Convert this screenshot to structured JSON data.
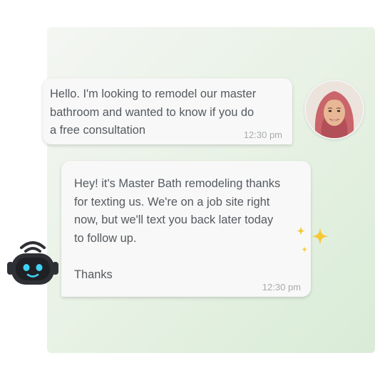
{
  "conversation": {
    "incoming": {
      "text": "Hello. I'm looking to remodel our master\nbathroom and wanted to know if you do\na free consultation",
      "time": "12:30 pm"
    },
    "outgoing": {
      "text": "Hey! it's Master Bath remodeling thanks\nfor texting us. We're on a job site right\nnow, but we'll text you back later today\nto follow up.\n\nThanks",
      "time": "12:30 pm"
    }
  },
  "icons": {
    "customer_avatar": "customer-avatar-photo",
    "bot_avatar": "robot-icon",
    "sparkle": "sparkle-icon"
  },
  "colors": {
    "panel_green": "#d9ecd7",
    "bubble_bg": "#f8f8f8",
    "text": "#555a5f",
    "timestamp": "#a7abae",
    "sparkle_yellow": "#f7c836",
    "bot_eyes": "#3fd3f5",
    "bot_body": "#2e3035"
  }
}
